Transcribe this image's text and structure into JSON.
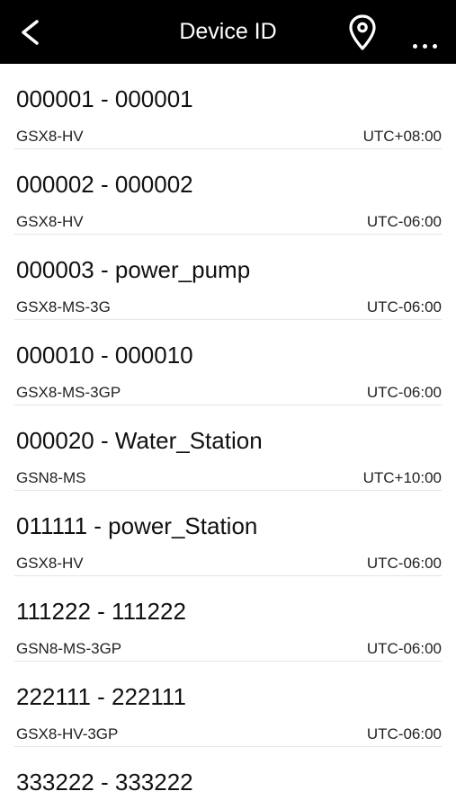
{
  "header": {
    "title": "Device ID",
    "back_icon": "back-chevron",
    "location_icon": "location-pin",
    "more_icon": "ellipsis"
  },
  "devices": [
    {
      "name": "000001 - 000001",
      "model": "GSX8-HV",
      "timezone": "UTC+08:00"
    },
    {
      "name": "000002 - 000002",
      "model": "GSX8-HV",
      "timezone": "UTC-06:00"
    },
    {
      "name": "000003 - power_pump",
      "model": "GSX8-MS-3G",
      "timezone": "UTC-06:00"
    },
    {
      "name": "000010 - 000010",
      "model": "GSX8-MS-3GP",
      "timezone": "UTC-06:00"
    },
    {
      "name": "000020 - Water_Station",
      "model": "GSN8-MS",
      "timezone": "UTC+10:00"
    },
    {
      "name": "011111 - power_Station",
      "model": "GSX8-HV",
      "timezone": "UTC-06:00"
    },
    {
      "name": "111222 - 111222",
      "model": "GSN8-MS-3GP",
      "timezone": "UTC-06:00"
    },
    {
      "name": "222111 - 222111",
      "model": "GSX8-HV-3GP",
      "timezone": "UTC-06:00"
    },
    {
      "name": "333222 - 333222"
    }
  ]
}
